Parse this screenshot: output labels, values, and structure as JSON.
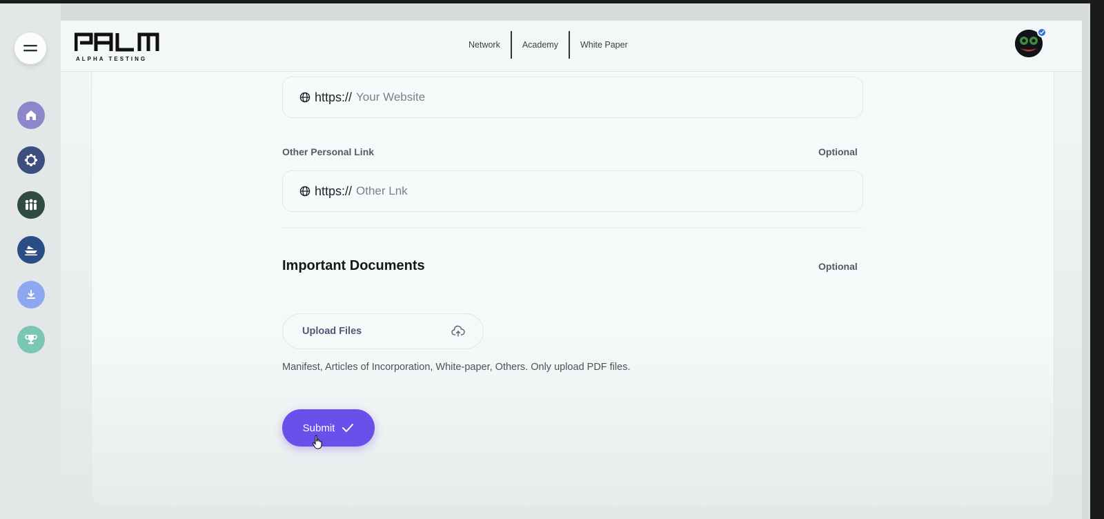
{
  "header": {
    "logo_text": "PALM",
    "logo_subtitle": "ALPHA TESTING",
    "nav": [
      "Network",
      "Academy",
      "White Paper"
    ]
  },
  "sidebar": {
    "items": [
      {
        "icon": "home-icon",
        "color": "#8d86c9"
      },
      {
        "icon": "network-icon",
        "color": "#3c4f7f"
      },
      {
        "icon": "community-icon",
        "color": "#2f4b43"
      },
      {
        "icon": "boat-icon",
        "color": "#2a4d86"
      },
      {
        "icon": "download-icon",
        "color": "#8fa7ee"
      },
      {
        "icon": "trophy-icon",
        "color": "#79c7b4"
      }
    ]
  },
  "form": {
    "website": {
      "prefix": "https://",
      "placeholder": "Your Website"
    },
    "other_link": {
      "label": "Other Personal Link",
      "optional": "Optional",
      "prefix": "https://",
      "placeholder": "Other Lnk"
    },
    "documents": {
      "title": "Important Documents",
      "optional": "Optional",
      "upload_label": "Upload Files",
      "help": "Manifest, Articles of Incorporation, White-paper, Others. Only upload PDF files."
    },
    "submit_label": "Submit"
  },
  "colors": {
    "accent": "#6a4fea",
    "verified": "#2f6fd6"
  }
}
